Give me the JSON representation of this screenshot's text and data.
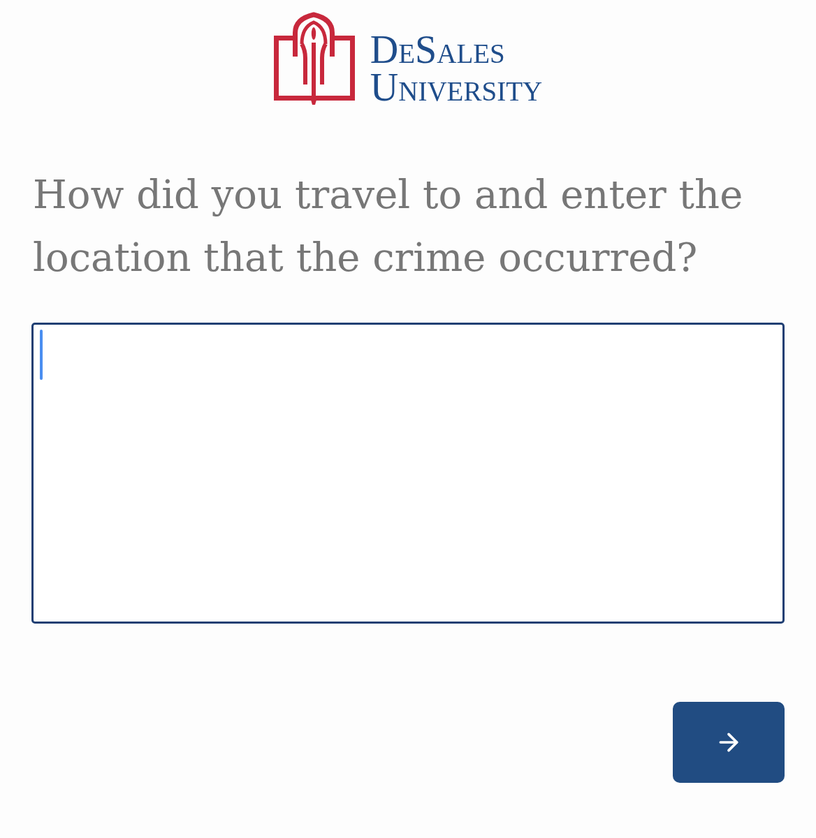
{
  "logo": {
    "lines": [
      "DeSales",
      "University"
    ]
  },
  "question": {
    "text": "How did you travel to and enter the location that the crime occurred?"
  },
  "answer_field": {
    "focused": true
  }
}
